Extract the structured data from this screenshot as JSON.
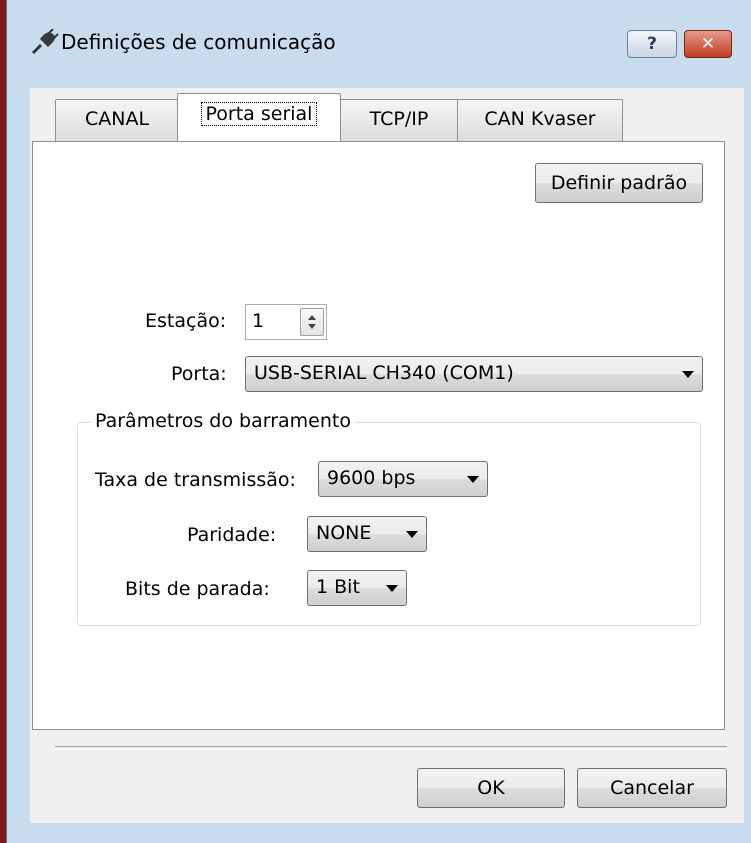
{
  "window": {
    "title": "Definições de comunicação",
    "help_label": "?",
    "close_label": "✕"
  },
  "tabs": [
    {
      "label": "CANAL"
    },
    {
      "label": "Porta serial"
    },
    {
      "label": "TCP/IP"
    },
    {
      "label": "CAN Kvaser"
    }
  ],
  "active_tab": "Porta serial",
  "panel": {
    "default_button": "Definir padrão",
    "station": {
      "label": "Estação:",
      "value": "1"
    },
    "port": {
      "label": "Porta:",
      "value": "USB-SERIAL CH340 (COM1)"
    },
    "bus_group": {
      "title": "Parâmetros do barramento",
      "baud": {
        "label": "Taxa de transmissão:",
        "value": "9600 bps"
      },
      "parity": {
        "label": "Paridade:",
        "value": "NONE"
      },
      "stop_bits": {
        "label": "Bits de parada:",
        "value": "1 Bit"
      }
    }
  },
  "footer": {
    "ok_label": "OK",
    "cancel_label": "Cancelar"
  },
  "colors": {
    "titlebar_bg": "#c9dcee",
    "close_button": "#c23a22",
    "panel_bg": "#ffffff"
  }
}
